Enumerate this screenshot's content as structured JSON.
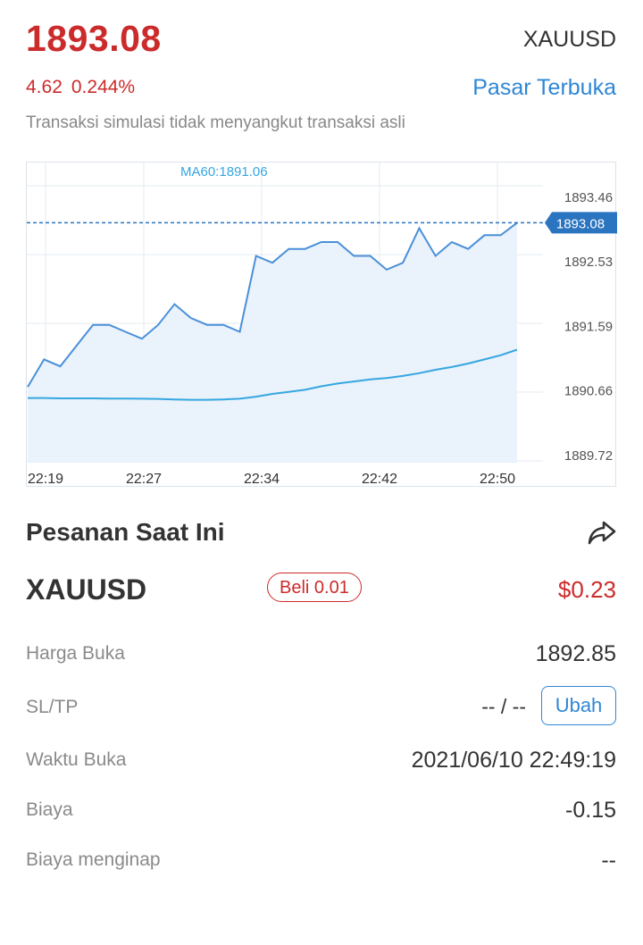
{
  "header": {
    "price": "1893.08",
    "symbol": "XAUUSD",
    "change": "4.62",
    "change_pct": "0.244%",
    "market_status": "Pasar Terbuka",
    "disclaimer": "Transaksi simulasi tidak menyangkut transaksi asli"
  },
  "chart_data": {
    "type": "line",
    "ma_label": "MA60:1891.06",
    "current_price_label": "1893.08",
    "current_price": 1893.08,
    "y_ticks": [
      "1893.46",
      "1892.53",
      "1891.59",
      "1890.66",
      "1889.72"
    ],
    "ylim": [
      1889.72,
      1893.46
    ],
    "x_ticks": [
      "22:19",
      "22:27",
      "22:34",
      "22:42",
      "22:50"
    ],
    "grid": true,
    "colors": {
      "price_line": "#4a90d9",
      "area_fill": "#eaf2fb",
      "ma_line": "#35a7e0",
      "current_tag": "#2a74c0",
      "grid": "#e6ebf0"
    },
    "series": [
      {
        "values": [
          1890.7,
          1891.1,
          1891.0,
          1891.3,
          1891.6,
          1891.6,
          1891.5,
          1891.4,
          1891.6,
          1891.9,
          1891.7,
          1891.6,
          1891.6,
          1891.5,
          1892.6,
          1892.5,
          1892.7,
          1892.7,
          1892.8,
          1892.8,
          1892.6,
          1892.6,
          1892.4,
          1892.5,
          1893.0,
          1892.6,
          1892.8,
          1892.7,
          1892.9,
          1892.9,
          1893.08
        ]
      },
      {
        "name": "MA60",
        "values": [
          1890.54,
          1890.54,
          1890.535,
          1890.535,
          1890.535,
          1890.533,
          1890.532,
          1890.53,
          1890.528,
          1890.52,
          1890.515,
          1890.515,
          1890.52,
          1890.53,
          1890.56,
          1890.6,
          1890.63,
          1890.66,
          1890.71,
          1890.75,
          1890.78,
          1890.81,
          1890.83,
          1890.86,
          1890.9,
          1890.95,
          1890.99,
          1891.04,
          1891.1,
          1891.16,
          1891.24
        ]
      }
    ]
  },
  "orders": {
    "title": "Pesanan Saat Ini",
    "share_icon": "share-icon",
    "symbol": "XAUUSD",
    "side_badge": "Beli 0.01",
    "pnl": "$0.23",
    "rows": {
      "open_price": {
        "label": "Harga Buka",
        "value": "1892.85"
      },
      "sltp": {
        "label": "SL/TP",
        "value": "-- / --",
        "button": "Ubah"
      },
      "open_time": {
        "label": "Waktu Buka",
        "value": "2021/06/10 22:49:19"
      },
      "fee": {
        "label": "Biaya",
        "value": "-0.15"
      },
      "swap": {
        "label": "Biaya menginap",
        "value": "--"
      }
    }
  }
}
